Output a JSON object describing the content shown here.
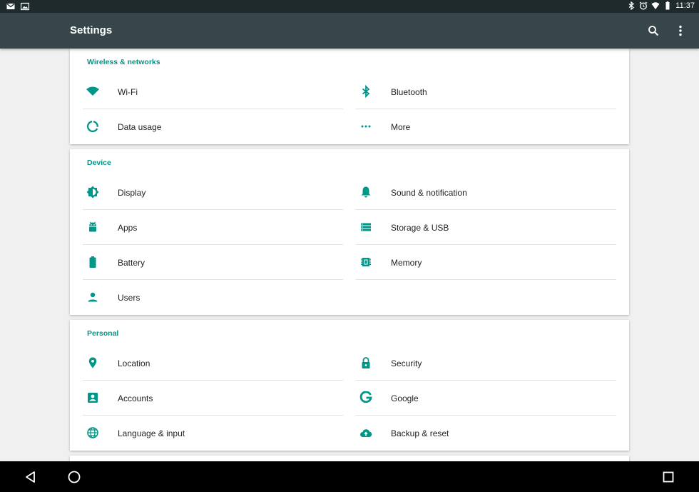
{
  "status_bar": {
    "time": "11:37",
    "left_icons": [
      "gmail-icon",
      "image-icon"
    ],
    "right_icons": [
      "bluetooth-icon",
      "alarm-icon",
      "wifi-icon",
      "battery-icon"
    ]
  },
  "app_bar": {
    "title": "Settings",
    "actions": [
      "search-icon",
      "overflow-menu-icon"
    ]
  },
  "sections": {
    "wireless": {
      "header": "Wireless & networks",
      "items": {
        "wifi": {
          "label": "Wi-Fi",
          "icon": "wifi-icon"
        },
        "bluetooth": {
          "label": "Bluetooth",
          "icon": "bluetooth-icon"
        },
        "data_usage": {
          "label": "Data usage",
          "icon": "data-usage-icon"
        },
        "more": {
          "label": "More",
          "icon": "more-horiz-icon"
        }
      }
    },
    "device": {
      "header": "Device",
      "items": {
        "display": {
          "label": "Display",
          "icon": "brightness-icon"
        },
        "sound": {
          "label": "Sound & notification",
          "icon": "bell-icon"
        },
        "apps": {
          "label": "Apps",
          "icon": "android-icon"
        },
        "storage": {
          "label": "Storage & USB",
          "icon": "storage-icon"
        },
        "battery": {
          "label": "Battery",
          "icon": "battery-icon"
        },
        "memory": {
          "label": "Memory",
          "icon": "memory-icon"
        },
        "users": {
          "label": "Users",
          "icon": "person-icon"
        }
      }
    },
    "personal": {
      "header": "Personal",
      "items": {
        "location": {
          "label": "Location",
          "icon": "location-pin-icon"
        },
        "security": {
          "label": "Security",
          "icon": "lock-icon"
        },
        "accounts": {
          "label": "Accounts",
          "icon": "account-box-icon"
        },
        "google": {
          "label": "Google",
          "icon": "google-icon"
        },
        "language": {
          "label": "Language & input",
          "icon": "globe-icon"
        },
        "backup": {
          "label": "Backup & reset",
          "icon": "cloud-upload-icon"
        }
      }
    }
  },
  "nav_bar": {
    "buttons": [
      "back-icon",
      "home-icon",
      "recents-icon"
    ]
  },
  "colors": {
    "accent": "#009688",
    "app_bar": "#36464b",
    "status_bar": "#1f2a2d",
    "background": "#f0f0f0"
  }
}
